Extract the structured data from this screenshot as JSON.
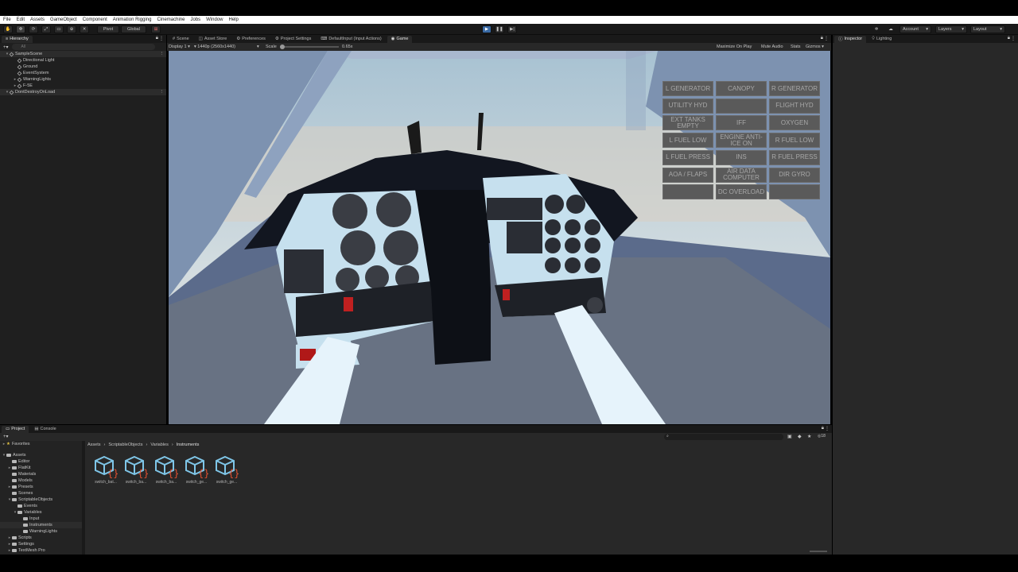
{
  "menu": [
    "File",
    "Edit",
    "Assets",
    "GameObject",
    "Component",
    "Animation Rigging",
    "Cinemachine",
    "Jobs",
    "Window",
    "Help"
  ],
  "toolbar": {
    "pivot": "Pivot",
    "global": "Global",
    "account": "Account",
    "layers": "Layers",
    "layout": "Layout"
  },
  "hierarchy": {
    "tab": "Hierarchy",
    "search_placeholder": "All",
    "items": [
      {
        "label": "SampleScene",
        "depth": 0,
        "selected": true
      },
      {
        "label": "Directional Light",
        "depth": 1
      },
      {
        "label": "Ground",
        "depth": 1
      },
      {
        "label": "EventSystem",
        "depth": 1
      },
      {
        "label": "WarningLights",
        "depth": 1
      },
      {
        "label": "F-5E",
        "depth": 1
      },
      {
        "label": "DontDestroyOnLoad",
        "depth": 0,
        "selected": true
      }
    ]
  },
  "center_tabs": [
    "Scene",
    "Asset Store",
    "Preferences",
    "Project Settings",
    "DefaultInput (Input Actions)",
    "Game"
  ],
  "game_bar": {
    "display": "Display 1",
    "resolution": "1440p (2560x1440)",
    "scale_label": "Scale",
    "scale_value": "0.65x",
    "maximize": "Maximize On Play",
    "mute": "Mute Audio",
    "stats": "Stats",
    "gizmos": "Gizmos"
  },
  "right_tabs": [
    "Inspector",
    "Lighting"
  ],
  "warning_panel": [
    [
      "L GENERATOR",
      "CANOPY",
      "R GENERATOR"
    ],
    [
      "UTILITY HYD",
      "",
      "FLIGHT HYD"
    ],
    [
      "EXT TANKS EMPTY",
      "IFF",
      "OXYGEN"
    ],
    [
      "L FUEL LOW",
      "ENGINE ANTI-ICE ON",
      "R FUEL LOW"
    ],
    [
      "L FUEL PRESS",
      "INS",
      "R FUEL PRESS"
    ],
    [
      "AOA / FLAPS",
      "AIR DATA COMPUTER",
      "DIR GYRO"
    ],
    [
      "",
      "DC OVERLOAD",
      ""
    ]
  ],
  "bottom_tabs": [
    "Project",
    "Console"
  ],
  "project_tree": {
    "favorites": "Favorites",
    "assets": "Assets",
    "items": [
      {
        "label": "Editor",
        "depth": 1
      },
      {
        "label": "FlatKit",
        "depth": 1
      },
      {
        "label": "Materials",
        "depth": 1
      },
      {
        "label": "Models",
        "depth": 1
      },
      {
        "label": "Presets",
        "depth": 1
      },
      {
        "label": "Scenes",
        "depth": 1
      },
      {
        "label": "ScriptableObjects",
        "depth": 1
      },
      {
        "label": "Events",
        "depth": 2
      },
      {
        "label": "Variables",
        "depth": 2
      },
      {
        "label": "Input",
        "depth": 3
      },
      {
        "label": "Instruments",
        "depth": 3,
        "selected": true
      },
      {
        "label": "WarningLights",
        "depth": 3
      },
      {
        "label": "Scripts",
        "depth": 1
      },
      {
        "label": "Settings",
        "depth": 1
      },
      {
        "label": "TextMesh Pro",
        "depth": 1
      }
    ]
  },
  "breadcrumb": [
    "Assets",
    "ScriptableObjects",
    "Variables",
    "Instruments"
  ],
  "asset_count": "18",
  "assets": [
    "switch_bat...",
    "switch_ba...",
    "switch_ba...",
    "switch_ge...",
    "switch_ge..."
  ]
}
